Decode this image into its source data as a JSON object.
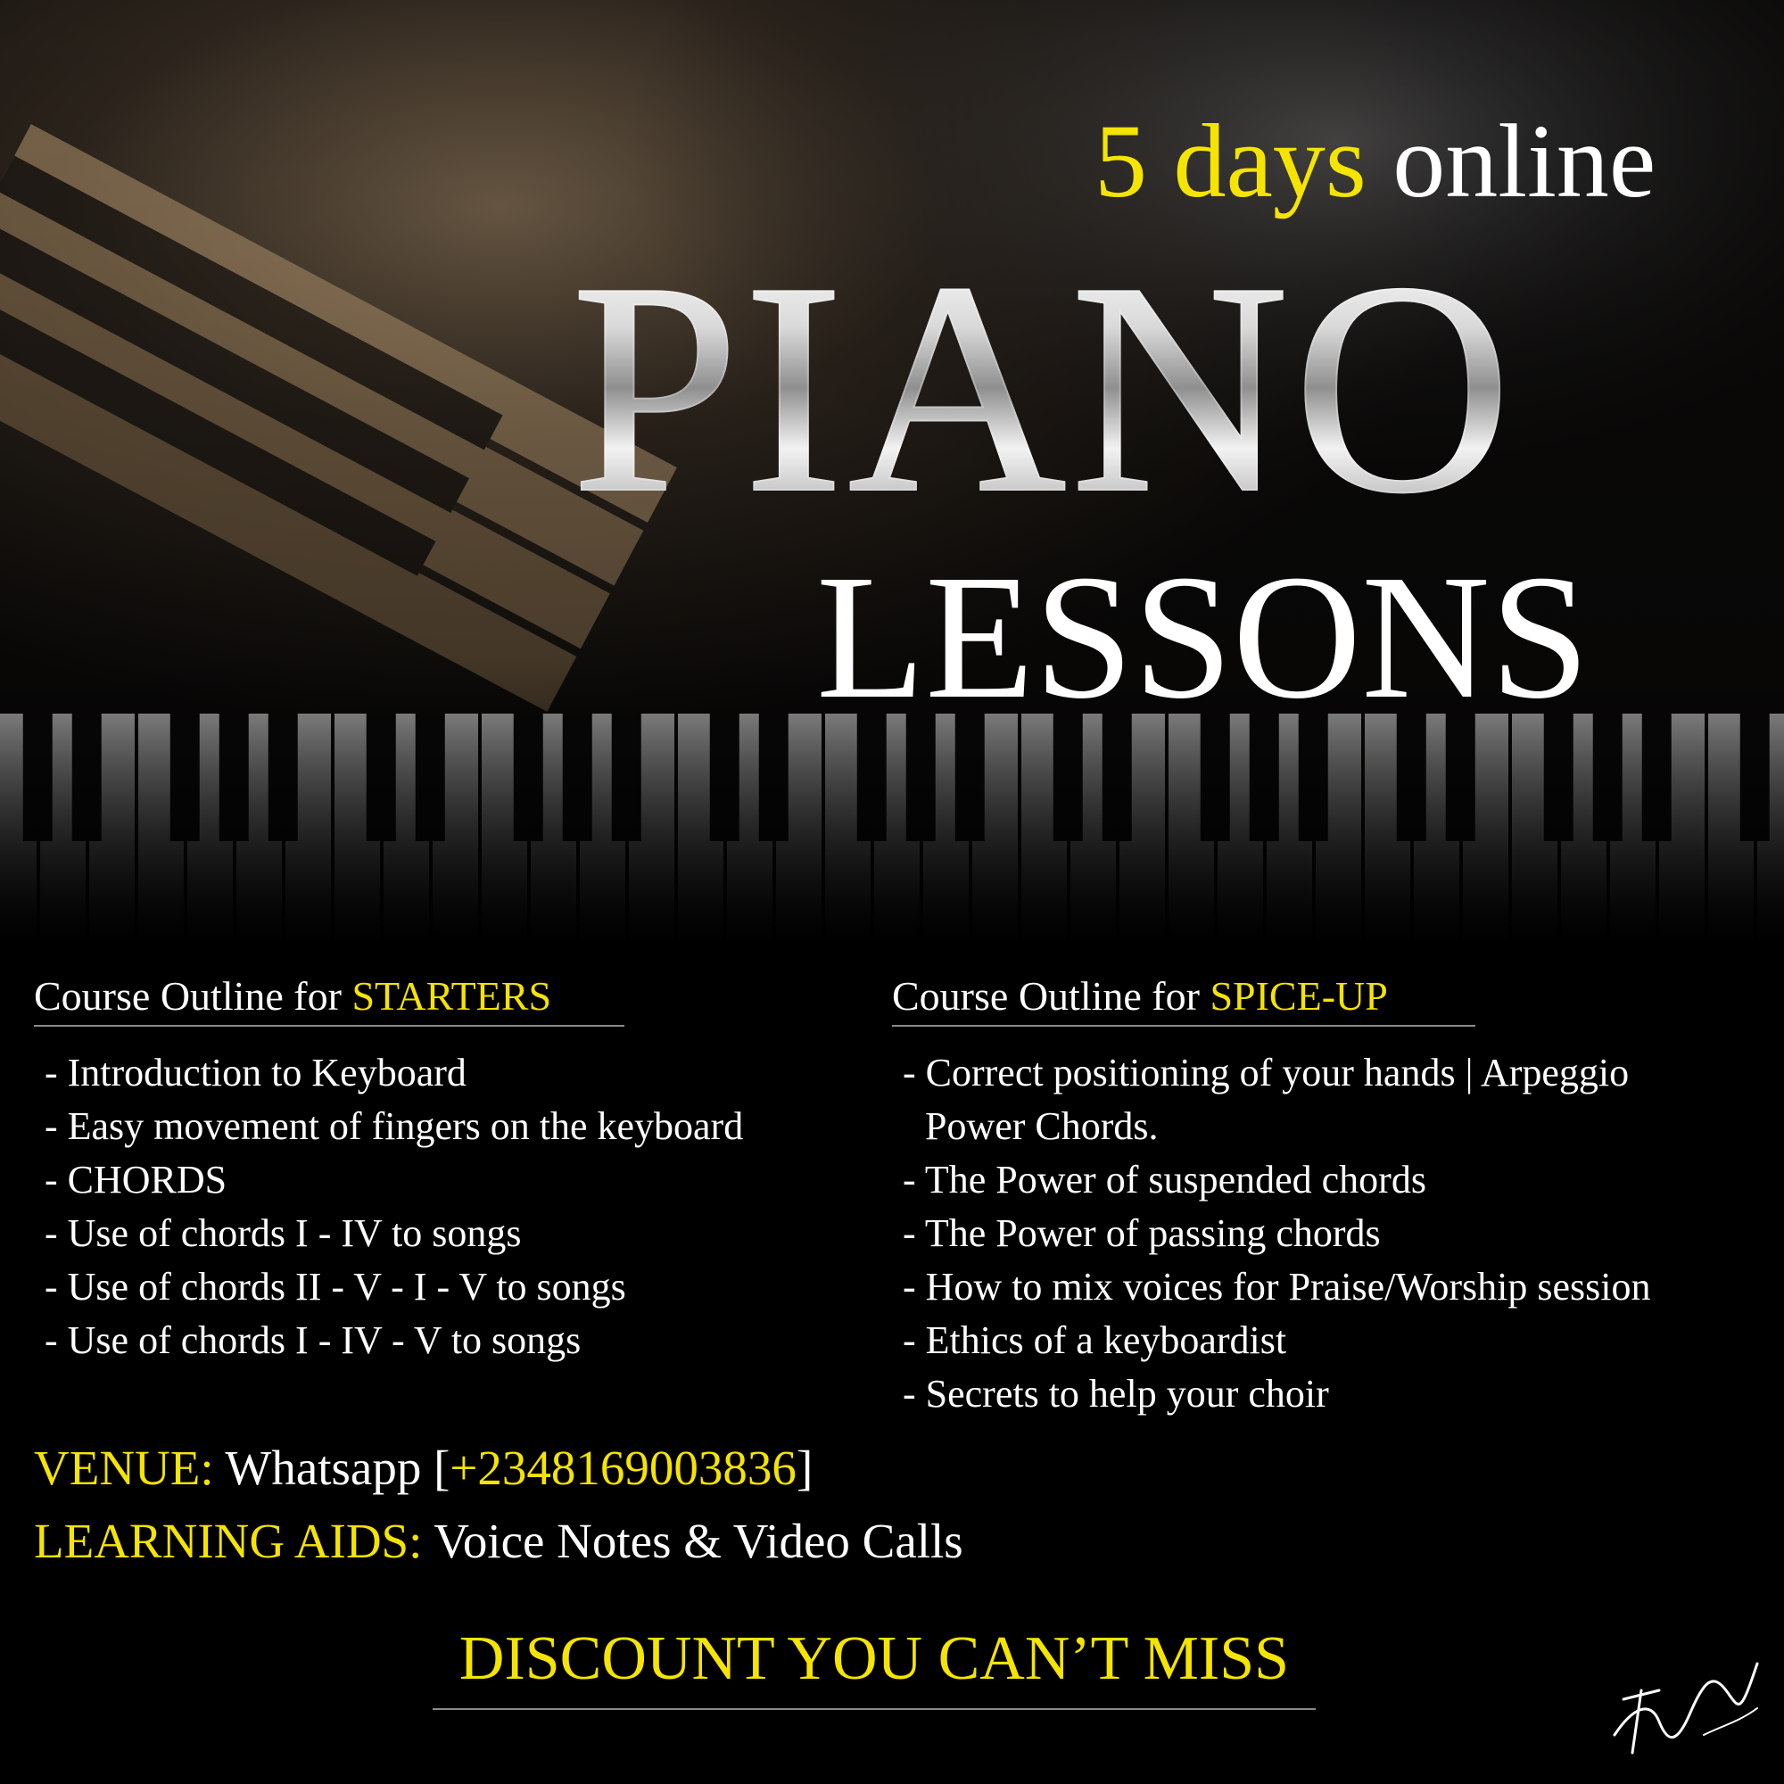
{
  "headline": {
    "highlight": "5 days",
    "rest": "online"
  },
  "title": {
    "main": "PIANO",
    "sub": "LESSONS"
  },
  "starters": {
    "heading_prefix": "Course Outline for",
    "heading_highlight": "STARTERS",
    "items": [
      "- Introduction to Keyboard",
      "- Easy movement of fingers on the keyboard",
      "- CHORDS",
      "- Use of  chords I - IV to songs",
      "- Use of chords II - V - I - V to songs",
      "- Use of chords I - IV - V to songs"
    ]
  },
  "spiceup": {
    "heading_prefix": "Course Outline for",
    "heading_highlight": "SPICE-UP",
    "items": [
      "- Correct positioning of your hands | Arpeggio",
      "Power Chords.",
      "- The Power of suspended chords",
      "- The Power of passing chords",
      "- How to mix voices for Praise/Worship session",
      "- Ethics of a keyboardist",
      "- Secrets to help your choir"
    ]
  },
  "venue": {
    "label": "VENUE:",
    "value_pre": "Whatsapp [",
    "phone": "+2348169003836",
    "value_post": "]"
  },
  "learning_aids": {
    "label": "LEARNING AIDS:",
    "value": "Voice Notes & Video Calls"
  },
  "discount": "DISCOUNT YOU CAN’T MISS",
  "colors": {
    "accent_yellow": "#f5e400",
    "text_white": "#ffffff",
    "background": "#000000",
    "rule_gray": "#8a8a8a"
  },
  "signature_text": "Tomiwa CAkande"
}
